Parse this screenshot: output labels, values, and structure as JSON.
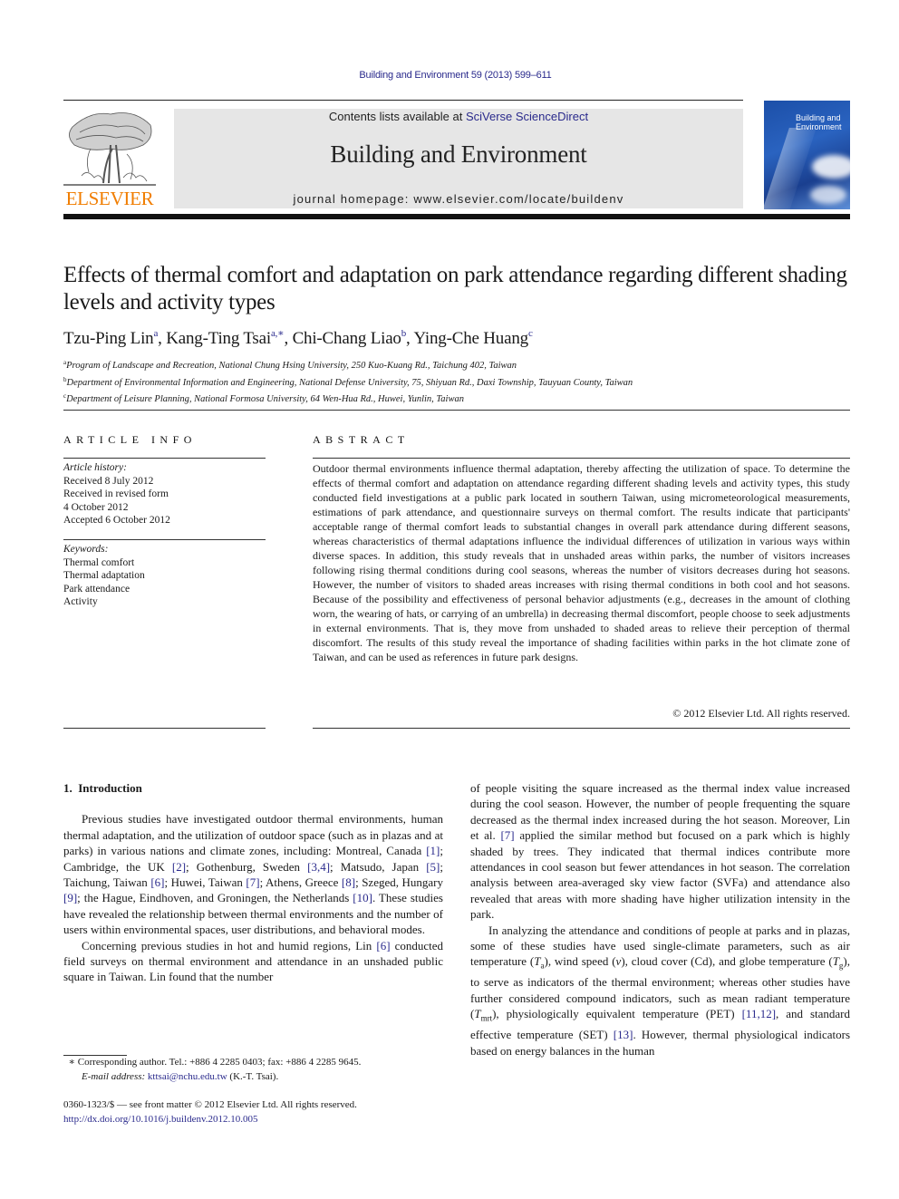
{
  "header": {
    "running_head": "Building and Environment 59 (2013) 599–611",
    "contents_prefix": "Contents lists available at ",
    "contents_link": "SciVerse ScienceDirect",
    "journal_title": "Building and Environment",
    "homepage_label": "journal homepage: ",
    "homepage_url": "www.elsevier.com/locate/buildenv",
    "publisher": "ELSEVIER",
    "cover_title": "Building and Environment",
    "colors": {
      "link": "#2a2a8c",
      "publisher_orange": "#f07d00",
      "banner_bg": "#e6e6e6",
      "cover_blue": "#1c4fa8"
    }
  },
  "article": {
    "title": "Effects of thermal comfort and adaptation on park attendance regarding different shading levels and activity types",
    "authors": [
      {
        "name": "Tzu-Ping Lin",
        "sup": "a",
        "sep": ", "
      },
      {
        "name": "Kang-Ting Tsai",
        "sup": "a,∗",
        "sep": ", "
      },
      {
        "name": "Chi-Chang Liao",
        "sup": "b",
        "sep": ", "
      },
      {
        "name": "Ying-Che Huang",
        "sup": "c",
        "sep": ""
      }
    ],
    "affiliations": [
      {
        "mark": "a",
        "text": "Program of Landscape and Recreation, National Chung Hsing University, 250 Kuo-Kuang Rd., Taichung 402, Taiwan"
      },
      {
        "mark": "b",
        "text": "Department of Environmental Information and Engineering, National Defense University, 75, Shiyuan Rd., Daxi Township, Tauyuan County, Taiwan"
      },
      {
        "mark": "c",
        "text": "Department of Leisure Planning, National Formosa University, 64 Wen-Hua Rd., Huwei, Yunlin, Taiwan"
      }
    ]
  },
  "article_info": {
    "heading": "ARTICLE INFO",
    "history_label": "Article history:",
    "history": [
      "Received 8 July 2012",
      "Received in revised form",
      "4 October 2012",
      "Accepted 6 October 2012"
    ],
    "keywords_label": "Keywords:",
    "keywords": [
      "Thermal comfort",
      "Thermal adaptation",
      "Park attendance",
      "Activity"
    ]
  },
  "abstract": {
    "heading": "ABSTRACT",
    "text": "Outdoor thermal environments influence thermal adaptation, thereby affecting the utilization of space. To determine the effects of thermal comfort and adaptation on attendance regarding different shading levels and activity types, this study conducted field investigations at a public park located in southern Taiwan, using micrometeorological measurements, estimations of park attendance, and questionnaire surveys on thermal comfort. The results indicate that participants' acceptable range of thermal comfort leads to substantial changes in overall park attendance during different seasons, whereas characteristics of thermal adaptations influence the individual differences of utilization in various ways within diverse spaces. In addition, this study reveals that in unshaded areas within parks, the number of visitors increases following rising thermal conditions during cool seasons, whereas the number of visitors decreases during hot seasons. However, the number of visitors to shaded areas increases with rising thermal conditions in both cool and hot seasons. Because of the possibility and effectiveness of personal behavior adjustments (e.g., decreases in the amount of clothing worn, the wearing of hats, or carrying of an umbrella) in decreasing thermal discomfort, people choose to seek adjustments in external environments. That is, they move from unshaded to shaded areas to relieve their perception of thermal discomfort. The results of this study reveal the importance of shading facilities within parks in the hot climate zone of Taiwan, and can be used as references in future park designs.",
    "copyright": "© 2012 Elsevier Ltd. All rights reserved."
  },
  "body": {
    "section_number": "1.",
    "section_title": "Introduction",
    "p1": [
      {
        "t": "Previous studies have investigated outdoor thermal environments, human thermal adaptation, and the utilization of outdoor space (such as in plazas and at parks) in various nations and climate zones, including: Montreal, Canada "
      },
      {
        "ref": "[1]"
      },
      {
        "t": "; Cambridge, the UK "
      },
      {
        "ref": "[2]"
      },
      {
        "t": "; Gothenburg, Sweden "
      },
      {
        "ref": "[3,4]"
      },
      {
        "t": "; Matsudo, Japan "
      },
      {
        "ref": "[5]"
      },
      {
        "t": "; Taichung, Taiwan "
      },
      {
        "ref": "[6]"
      },
      {
        "t": "; Huwei, Taiwan "
      },
      {
        "ref": "[7]"
      },
      {
        "t": "; Athens, Greece "
      },
      {
        "ref": "[8]"
      },
      {
        "t": "; Szeged, Hungary "
      },
      {
        "ref": "[9]"
      },
      {
        "t": "; the Hague, Eindhoven, and Groningen, the Netherlands "
      },
      {
        "ref": "[10]"
      },
      {
        "t": ". These studies have revealed the relationship between thermal environments and the number of users within environmental spaces, user distributions, and behavioral modes."
      }
    ],
    "p2": [
      {
        "t": "Concerning previous studies in hot and humid regions, Lin "
      },
      {
        "ref": "[6]"
      },
      {
        "t": " conducted field surveys on thermal environment and attendance in an unshaded public square in Taiwan. Lin found that the number "
      }
    ],
    "p2_cont": [
      {
        "t": "of people visiting the square increased as the thermal index value increased during the cool season. However, the number of people frequenting the square decreased as the thermal index increased during the hot season. Moreover, Lin et al. "
      },
      {
        "ref": "[7]"
      },
      {
        "t": " applied the similar method but focused on a park which is highly shaded by trees. They indicated that thermal indices contribute more attendances in cool season but fewer attendances in hot season. The correlation analysis between area-averaged sky view factor (SVFa) and attendance also revealed that areas with more shading have higher utilization intensity in the park."
      }
    ],
    "p3": [
      {
        "t": "In analyzing the attendance and conditions of people at parks and in plazas, some of these studies have used single-climate parameters, such as air temperature ("
      },
      {
        "it": "T",
        "sub": "a"
      },
      {
        "t": "), wind speed ("
      },
      {
        "it": "v"
      },
      {
        "t": "), cloud cover (Cd), and globe temperature ("
      },
      {
        "it": "T",
        "sub": "g"
      },
      {
        "t": "), to serve as indicators of the thermal environment; whereas other studies have further considered compound indicators, such as mean radiant temperature ("
      },
      {
        "it": "T",
        "sub": "mrt"
      },
      {
        "t": "), physiologically equivalent temperature (PET) "
      },
      {
        "ref": "[11,12]"
      },
      {
        "t": ", and standard effective temperature (SET) "
      },
      {
        "ref": "[13]"
      },
      {
        "t": ". However, thermal physiological indicators based on energy balances in the human"
      }
    ]
  },
  "footnotes": {
    "star": "∗",
    "corresponding": " Corresponding author. Tel.: +886 4 2285 0403; fax: +886 4 2285 9645.",
    "email_label": "E-mail address: ",
    "email": "kttsai@nchu.edu.tw",
    "email_suffix": " (K.-T. Tsai).",
    "front_matter": "0360-1323/$ — see front matter © 2012 Elsevier Ltd. All rights reserved.",
    "doi": "http://dx.doi.org/10.1016/j.buildenv.2012.10.005"
  }
}
